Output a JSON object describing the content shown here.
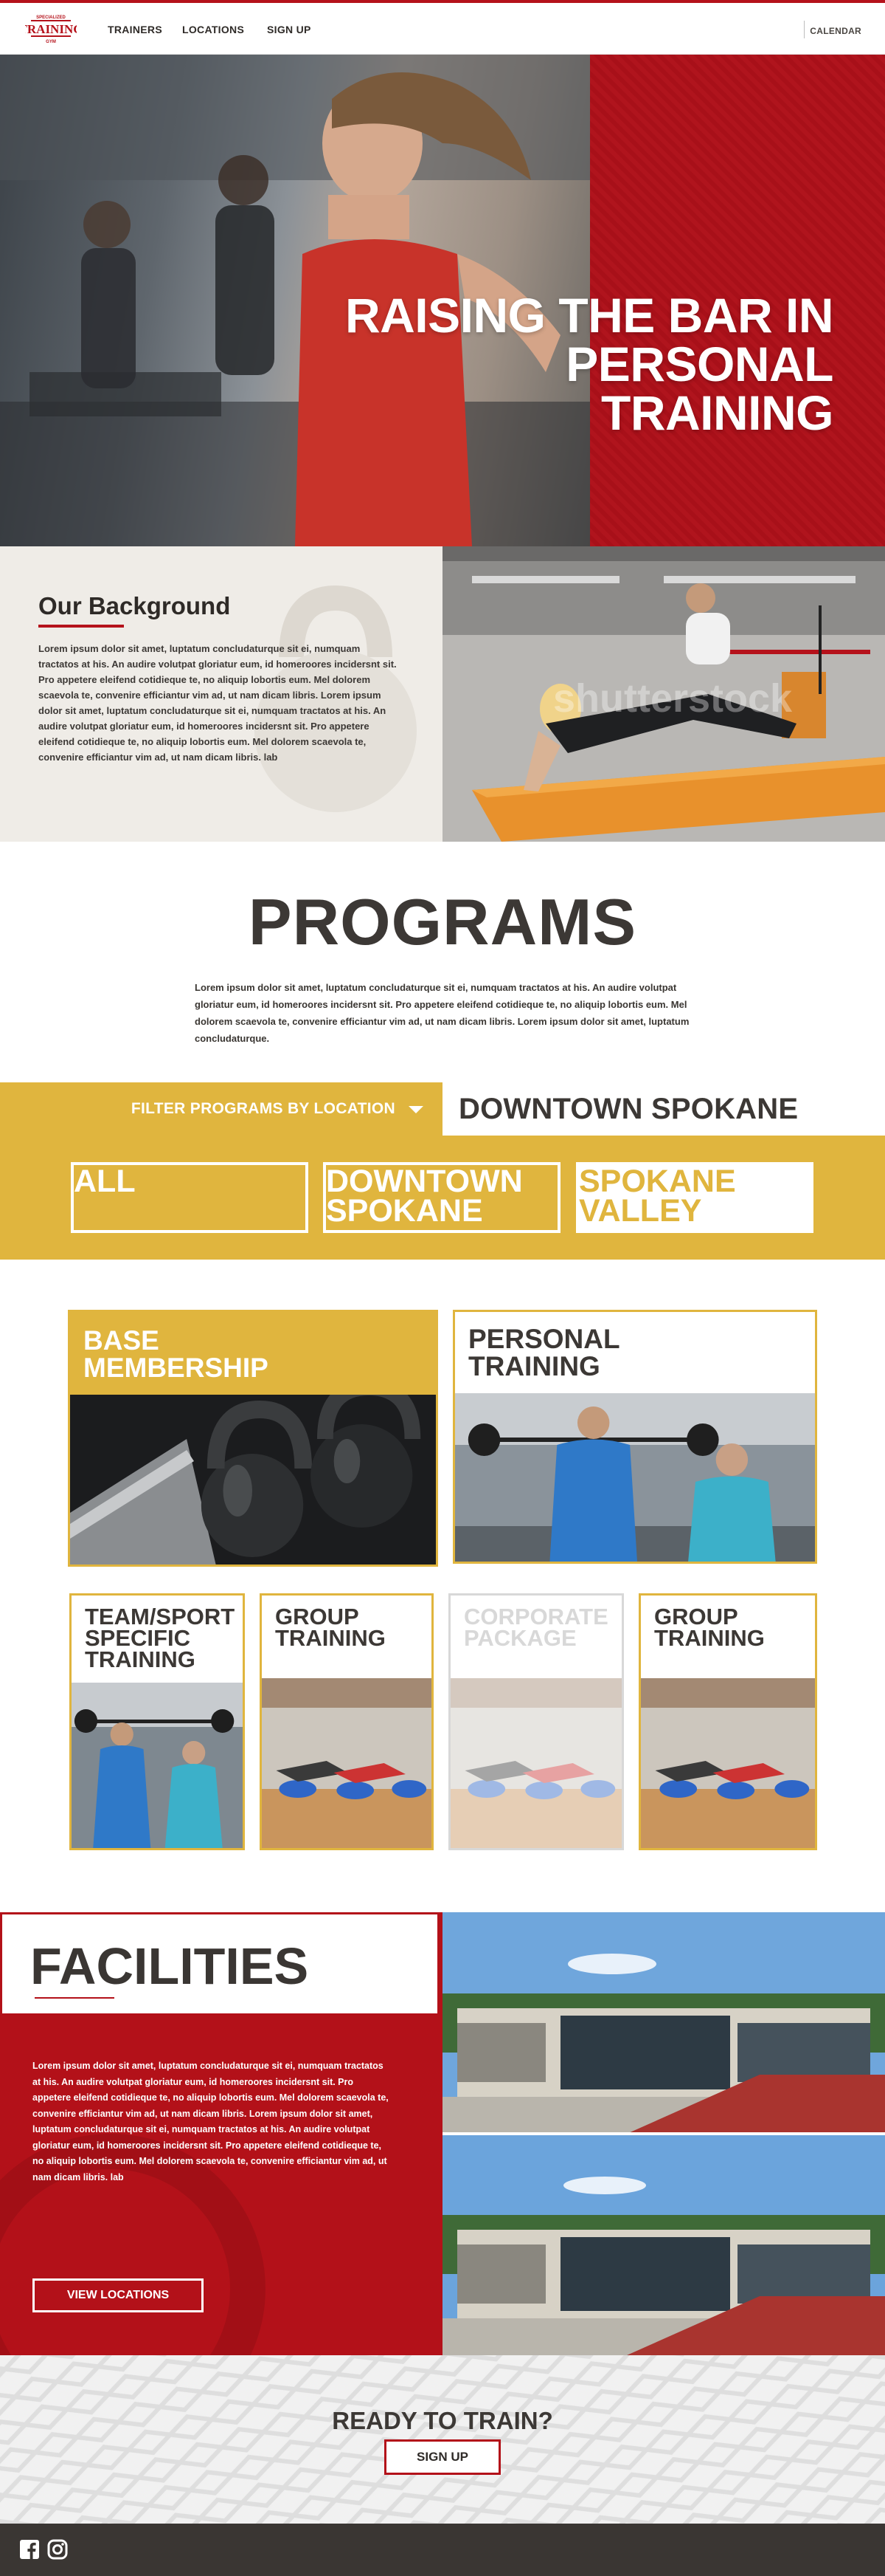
{
  "brand": {
    "logo_top": "SPECIALIZED",
    "logo_main": "TRAINING",
    "logo_bottom": "GYM",
    "red": "#b5121b",
    "gold": "#e0b53e",
    "dark": "#3a3633"
  },
  "nav": {
    "links": [
      "TRAINERS",
      "LOCATIONS",
      "SIGN UP"
    ],
    "calendar": "CALENDAR"
  },
  "hero": {
    "title_line1": "RAISING THE BAR IN PERSONAL",
    "title_line2": "TRAINING"
  },
  "background": {
    "title": "Our Background",
    "text": "Lorem ipsum dolor sit amet, luptatum concludaturque sit ei, numquam tractatos at his. An audire volutpat gloriatur eum, id homeroores incidersnt sit. Pro appetere eleifend cotidieque te, no aliquip lobortis eum. Mel dolorem scaevola te, convenire efficiantur vim ad, ut nam dicam libris. Lorem ipsum dolor sit amet, luptatum concludaturque sit ei, numquam tractatos at his. An audire volutpat gloriatur eum, id homeroores incidersnt sit. Pro appetere eleifend cotidieque te, no aliquip lobortis eum. Mel dolorem scaevola te, convenire efficiantur vim ad, ut nam dicam libris. lab",
    "watermark": "shutterstock"
  },
  "programs": {
    "title": "PROGRAMS",
    "text": "Lorem ipsum dolor sit amet, luptatum concludaturque sit ei, numquam tractatos at his. An audire volutpat gloriatur eum, id homeroores incidersnt sit. Pro appetere eleifend cotidieque te, no aliquip lobortis eum. Mel dolorem scaevola te, convenire efficiantur vim ad, ut nam dicam libris. Lorem ipsum dolor sit amet, luptatum concludaturque.",
    "filter_label": "FILTER PROGRAMS BY LOCATION",
    "filter_value": "DOWNTOWN SPOKANE",
    "locations": [
      {
        "label_line1": "ALL",
        "label_line2": "",
        "active": false
      },
      {
        "label_line1": "DOWNTOWN",
        "label_line2": "SPOKANE",
        "active": false
      },
      {
        "label_line1": "SPOKANE",
        "label_line2": "VALLEY",
        "active": true
      }
    ],
    "cards": [
      {
        "title_line1": "BASE",
        "title_line2": "MEMBERSHIP",
        "title_line3": "",
        "style": "gold",
        "image": "kettlebells-photo"
      },
      {
        "title_line1": "PERSONAL",
        "title_line2": "TRAINING",
        "title_line3": "",
        "style": "default",
        "image": "trainer-barbell-photo"
      },
      {
        "title_line1": "TEAM/SPORT",
        "title_line2": "SPECIFIC",
        "title_line3": "TRAINING",
        "style": "default",
        "image": "trainer-squat-photo"
      },
      {
        "title_line1": "GROUP",
        "title_line2": "TRAINING",
        "title_line3": "",
        "style": "default",
        "image": "group-class-photo"
      },
      {
        "title_line1": "CORPORATE",
        "title_line2": "PACKAGE",
        "title_line3": "",
        "style": "faded",
        "image": "group-class-photo"
      },
      {
        "title_line1": "GROUP",
        "title_line2": "TRAINING",
        "title_line3": "",
        "style": "default",
        "image": "group-class-photo"
      }
    ]
  },
  "facilities": {
    "title": "FACILITIES",
    "text": "Lorem ipsum dolor sit amet, luptatum concludaturque sit ei, numquam tractatos at his. An audire volutpat gloriatur eum, id homeroores incidersnt sit. Pro appetere eleifend cotidieque te, no aliquip lobortis eum. Mel dolorem scaevola te, convenire efficiantur vim ad, ut nam dicam libris. Lorem ipsum dolor sit amet, luptatum concludaturque sit ei, numquam tractatos at his. An audire volutpat gloriatur eum, id homeroores incidersnt sit. Pro appetere eleifend cotidieque te, no aliquip lobortis eum. Mel dolorem scaevola te, convenire efficiantur vim ad, ut nam dicam libris. lab",
    "button": "VIEW LOCATIONS"
  },
  "cta": {
    "title": "READY TO TRAIN?",
    "button": "SIGN UP"
  },
  "footer": {
    "icons": [
      "facebook-icon",
      "instagram-icon"
    ]
  }
}
